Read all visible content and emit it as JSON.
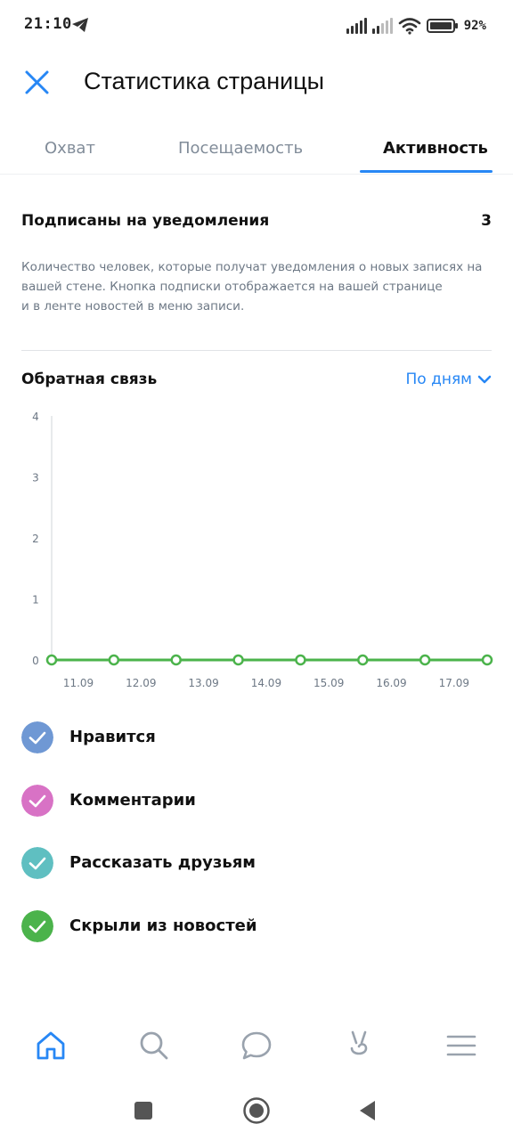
{
  "status_bar": {
    "time": "21:10",
    "battery_percent": "92%",
    "icons": [
      "telegram-icon",
      "signal-icon",
      "signal-icon",
      "wifi-icon",
      "battery-icon"
    ]
  },
  "header": {
    "title": "Статистика страницы",
    "close_icon": "close-icon"
  },
  "tabs": [
    {
      "label": "Охват",
      "active": false
    },
    {
      "label": "Посещаемость",
      "active": false
    },
    {
      "label": "Активность",
      "active": true
    }
  ],
  "subscribed": {
    "title": "Подписаны на уведомления",
    "count": "3",
    "description_line1": "Количество человек, которые получат уведомления о новых записях на",
    "description_line2": "вашей стене. Кнопка подписки отображается на вашей странице",
    "description_line3": "и в ленте новостей в меню записи."
  },
  "feedback": {
    "title": "Обратная связь",
    "period_label": "По дням"
  },
  "chart_data": {
    "type": "line",
    "categories": [
      "11.09",
      "12.09",
      "13.09",
      "14.09",
      "15.09",
      "16.09",
      "17.09"
    ],
    "y_ticks": [
      "0",
      "1",
      "2",
      "3",
      "4"
    ],
    "ylim": [
      0,
      4
    ],
    "grid": false,
    "series": [
      {
        "values": [
          0,
          0,
          0,
          0,
          0,
          0,
          0,
          0
        ],
        "color": "#4bb34b"
      }
    ]
  },
  "legend": [
    {
      "label": "Нравится",
      "color": "#6f98d4"
    },
    {
      "label": "Комментарии",
      "color": "#d872c5"
    },
    {
      "label": "Рассказать друзьям",
      "color": "#5fbfc1"
    },
    {
      "label": "Скрыли из новостей",
      "color": "#4bb34b"
    }
  ],
  "bottom_nav": {
    "items": [
      "home-icon",
      "search-icon",
      "messages-icon",
      "clips-icon",
      "menu-icon"
    ],
    "active_color": "#2787f5",
    "inactive_color": "#99a2ad"
  },
  "system_nav": [
    "recents-icon",
    "home-button-icon",
    "back-icon"
  ]
}
